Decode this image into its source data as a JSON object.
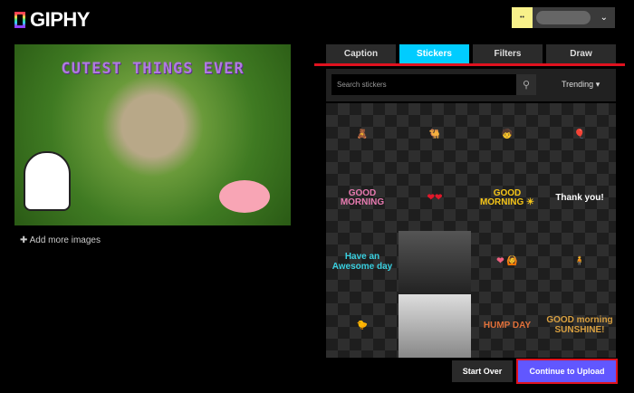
{
  "header": {
    "logo": "GIPHY",
    "user_avatar": "••"
  },
  "preview": {
    "caption": "CUTEST THINGS EVER",
    "add_more": "Add more images"
  },
  "tabs": [
    {
      "label": "Caption"
    },
    {
      "label": "Stickers",
      "active": true
    },
    {
      "label": "Filters"
    },
    {
      "label": "Draw"
    }
  ],
  "search": {
    "placeholder": "Search stickers",
    "sort": "Trending"
  },
  "stickers": [
    {
      "label": "🧸",
      "color": "#e8c070"
    },
    {
      "label": "🐫",
      "color": "#c98a3a"
    },
    {
      "label": "🧒",
      "color": "#4a9ae8"
    },
    {
      "label": "🎈",
      "color": "#f0d040"
    },
    {
      "label": "GOOD MORNING",
      "color": "#e77ab0"
    },
    {
      "label": "❤❤",
      "color": "#e0182a"
    },
    {
      "label": "GOOD MORNING ☀",
      "color": "#f5c518"
    },
    {
      "label": "Thank you!",
      "color": "#ffffff"
    },
    {
      "label": "Have an Awesome day",
      "color": "#3ad0e0"
    },
    {
      "label": "",
      "color": "#777"
    },
    {
      "label": "❤ 🙆",
      "color": "#f06080"
    },
    {
      "label": "🧍",
      "color": "#e08050"
    },
    {
      "label": "🐤",
      "color": "#f5d020"
    },
    {
      "label": "",
      "color": "#ccc"
    },
    {
      "label": "HUMP DAY",
      "color": "#e0703a"
    },
    {
      "label": "GOOD morning SUNSHINE!",
      "color": "#d9a040"
    }
  ],
  "buttons": {
    "start_over": "Start Over",
    "continue": "Continue to Upload"
  },
  "colors": {
    "accent": "#00ccff",
    "primary": "#6157ff",
    "highlight": "#e0121f"
  }
}
